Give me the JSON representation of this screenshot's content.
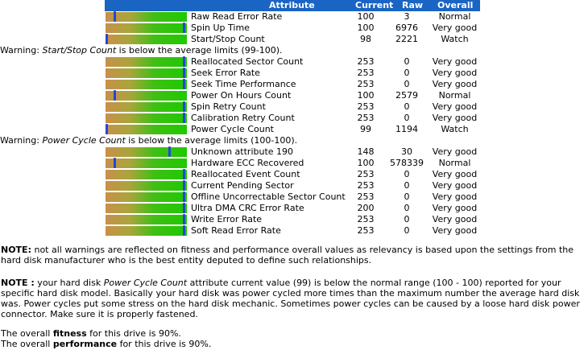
{
  "table": {
    "headers": {
      "attribute": "Attribute",
      "current": "Current",
      "raw": "Raw",
      "overall": "Overall"
    },
    "rows": [
      {
        "type": "attr",
        "name": "Raw Read Error Rate",
        "current": "100",
        "raw": "3",
        "overall": "Normal",
        "level": 0.1
      },
      {
        "type": "attr",
        "name": "Spin Up Time",
        "current": "100",
        "raw": "6976",
        "overall": "Very good",
        "level": 0.99
      },
      {
        "type": "attr",
        "name": "Start/Stop Count",
        "current": "98",
        "raw": "2221",
        "overall": "Watch",
        "level": 0.0
      },
      {
        "type": "warning",
        "prefix": "Warning: ",
        "attr": "Start/Stop Count",
        "suffix": " is below the average limits (99-100)."
      },
      {
        "type": "attr",
        "name": "Reallocated Sector Count",
        "current": "253",
        "raw": "0",
        "overall": "Very good",
        "level": 0.99
      },
      {
        "type": "attr",
        "name": "Seek Error Rate",
        "current": "253",
        "raw": "0",
        "overall": "Very good",
        "level": 0.99
      },
      {
        "type": "attr",
        "name": "Seek Time Performance",
        "current": "253",
        "raw": "0",
        "overall": "Very good",
        "level": 0.99
      },
      {
        "type": "attr",
        "name": "Power On Hours Count",
        "current": "100",
        "raw": "2579",
        "overall": "Normal",
        "level": 0.1
      },
      {
        "type": "attr",
        "name": "Spin Retry Count",
        "current": "253",
        "raw": "0",
        "overall": "Very good",
        "level": 0.99
      },
      {
        "type": "attr",
        "name": "Calibration Retry Count",
        "current": "253",
        "raw": "0",
        "overall": "Very good",
        "level": 0.99
      },
      {
        "type": "attr",
        "name": "Power Cycle Count",
        "current": "99",
        "raw": "1194",
        "overall": "Watch",
        "level": 0.0
      },
      {
        "type": "warning",
        "prefix": "Warning: ",
        "attr": "Power Cycle Count",
        "suffix": " is below the average limits (100-100)."
      },
      {
        "type": "attr",
        "name": "Unknown attribute 190",
        "current": "148",
        "raw": "30",
        "overall": "Very good",
        "level": 0.8
      },
      {
        "type": "attr",
        "name": "Hardware ECC Recovered",
        "current": "100",
        "raw": "578339",
        "overall": "Normal",
        "level": 0.1
      },
      {
        "type": "attr",
        "name": "Reallocated Event Count",
        "current": "253",
        "raw": "0",
        "overall": "Very good",
        "level": 0.99
      },
      {
        "type": "attr",
        "name": "Current Pending Sector",
        "current": "253",
        "raw": "0",
        "overall": "Very good",
        "level": 0.99
      },
      {
        "type": "attr",
        "name": "Offline Uncorrectable Sector Count",
        "current": "253",
        "raw": "0",
        "overall": "Very good",
        "level": 0.99
      },
      {
        "type": "attr",
        "name": "Ultra DMA CRC Error Rate",
        "current": "200",
        "raw": "0",
        "overall": "Very good",
        "level": 0.99
      },
      {
        "type": "attr",
        "name": "Write Error Rate",
        "current": "253",
        "raw": "0",
        "overall": "Very good",
        "level": 0.99
      },
      {
        "type": "attr",
        "name": "Soft Read Error Rate",
        "current": "253",
        "raw": "0",
        "overall": "Very good",
        "level": 0.99
      }
    ]
  },
  "notes": {
    "note1_label": "NOTE:",
    "note1_text": " not all warnings are reflected on fitness and performance overall values as relevancy is based upon the settings from the hard disk manufacturer who is the best entity deputed to define such relationships.",
    "note2_label": "NOTE :",
    "note2_pre": " your hard disk ",
    "note2_attr": "Power Cycle Count",
    "note2_text": " attribute current value (99) is below the normal range (100 - 100) reported for your specific hard disk model. Basically your hard disk was power cycled more times than the maximum number the average hard disk was. Power cycles put some stress on the hard disk mechanic. Sometimes power cycles can be caused by a loose hard disk power connector. Make sure it is properly fastened.",
    "fitness_pre": "The overall ",
    "fitness_word": "fitness",
    "fitness_post": " for this drive is 90%.",
    "performance_pre": "The overall ",
    "performance_word": "performance",
    "performance_post": " for this drive is 90%."
  }
}
